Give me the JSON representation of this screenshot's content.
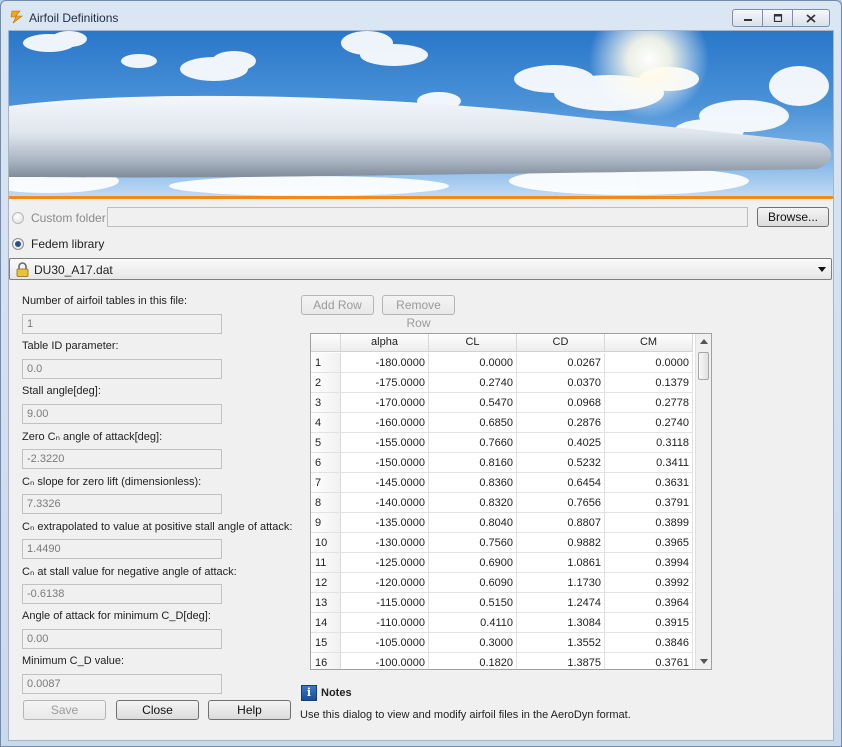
{
  "window": {
    "title": "Airfoil Definitions"
  },
  "source": {
    "custom_folder_label": "Custom folder",
    "custom_folder_path": "",
    "browse_label": "Browse...",
    "fedem_library_label": "Fedem library",
    "selected_file": "DU30_A17.dat"
  },
  "params": [
    {
      "label": "Number of airfoil tables in this file:",
      "value": "1"
    },
    {
      "label": "Table ID parameter:",
      "value": "0.0"
    },
    {
      "label": "Stall angle[deg]:",
      "value": "9.00"
    },
    {
      "label": "Zero Cₙ angle of attack[deg]:",
      "value": "-2.3220"
    },
    {
      "label": "Cₙ slope for zero lift (dimensionless):",
      "value": "7.3326"
    },
    {
      "label": "Cₙ extrapolated to value at positive stall angle of attack:",
      "value": "1.4490"
    },
    {
      "label": "Cₙ at stall value for negative angle of attack:",
      "value": "-0.6138"
    },
    {
      "label": "Angle of attack for minimum C_D[deg]:",
      "value": "0.00"
    },
    {
      "label": "Minimum C_D value:",
      "value": "0.0087"
    }
  ],
  "table_buttons": {
    "add_row": "Add Row",
    "remove_row": "Remove Row"
  },
  "table": {
    "columns": [
      "alpha",
      "CL",
      "CD",
      "CM"
    ],
    "rows": [
      {
        "n": "1",
        "alpha": "-180.0000",
        "cl": "0.0000",
        "cd": "0.0267",
        "cm": "0.0000"
      },
      {
        "n": "2",
        "alpha": "-175.0000",
        "cl": "0.2740",
        "cd": "0.0370",
        "cm": "0.1379"
      },
      {
        "n": "3",
        "alpha": "-170.0000",
        "cl": "0.5470",
        "cd": "0.0968",
        "cm": "0.2778"
      },
      {
        "n": "4",
        "alpha": "-160.0000",
        "cl": "0.6850",
        "cd": "0.2876",
        "cm": "0.2740"
      },
      {
        "n": "5",
        "alpha": "-155.0000",
        "cl": "0.7660",
        "cd": "0.4025",
        "cm": "0.3118"
      },
      {
        "n": "6",
        "alpha": "-150.0000",
        "cl": "0.8160",
        "cd": "0.5232",
        "cm": "0.3411"
      },
      {
        "n": "7",
        "alpha": "-145.0000",
        "cl": "0.8360",
        "cd": "0.6454",
        "cm": "0.3631"
      },
      {
        "n": "8",
        "alpha": "-140.0000",
        "cl": "0.8320",
        "cd": "0.7656",
        "cm": "0.3791"
      },
      {
        "n": "9",
        "alpha": "-135.0000",
        "cl": "0.8040",
        "cd": "0.8807",
        "cm": "0.3899"
      },
      {
        "n": "10",
        "alpha": "-130.0000",
        "cl": "0.7560",
        "cd": "0.9882",
        "cm": "0.3965"
      },
      {
        "n": "11",
        "alpha": "-125.0000",
        "cl": "0.6900",
        "cd": "1.0861",
        "cm": "0.3994"
      },
      {
        "n": "12",
        "alpha": "-120.0000",
        "cl": "0.6090",
        "cd": "1.1730",
        "cm": "0.3992"
      },
      {
        "n": "13",
        "alpha": "-115.0000",
        "cl": "0.5150",
        "cd": "1.2474",
        "cm": "0.3964"
      },
      {
        "n": "14",
        "alpha": "-110.0000",
        "cl": "0.4110",
        "cd": "1.3084",
        "cm": "0.3915"
      },
      {
        "n": "15",
        "alpha": "-105.0000",
        "cl": "0.3000",
        "cd": "1.3552",
        "cm": "0.3846"
      },
      {
        "n": "16",
        "alpha": "-100.0000",
        "cl": "0.1820",
        "cd": "1.3875",
        "cm": "0.3761"
      }
    ]
  },
  "notes": {
    "title": "Notes",
    "text": "Use this dialog to view and modify airfoil files in the AeroDyn format."
  },
  "footer": {
    "save": "Save",
    "close": "Close",
    "help": "Help"
  },
  "colors": {
    "accent_stripe": "#f08a19",
    "sky": "#4b92d8"
  }
}
